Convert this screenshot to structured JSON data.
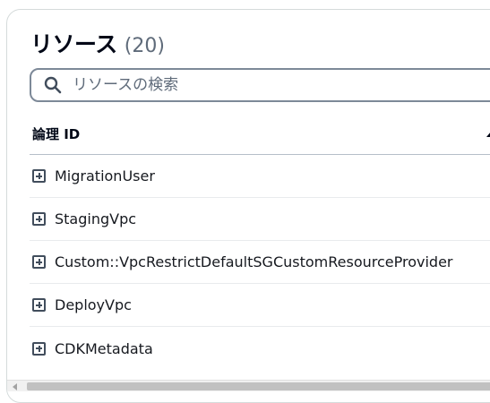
{
  "panel": {
    "title": "リソース",
    "count": "(20)"
  },
  "search": {
    "placeholder": "リソースの検索",
    "value": "",
    "icon": "search-icon"
  },
  "table": {
    "column_header": "論理 ID",
    "sort": "ascending",
    "rows": [
      {
        "label": "MigrationUser",
        "icon": "expand-icon"
      },
      {
        "label": "StagingVpc",
        "icon": "expand-icon"
      },
      {
        "label": "Custom::VpcRestrictDefaultSGCustomResourceProvider",
        "icon": "expand-icon"
      },
      {
        "label": "DeployVpc",
        "icon": "expand-icon"
      },
      {
        "label": "CDKMetadata",
        "icon": "expand-icon"
      }
    ]
  },
  "colors": {
    "border": "#d5dbdb",
    "text": "#16191f",
    "muted": "#5f6b7a",
    "search_border": "#7d8998",
    "icon": "#414d5c"
  }
}
